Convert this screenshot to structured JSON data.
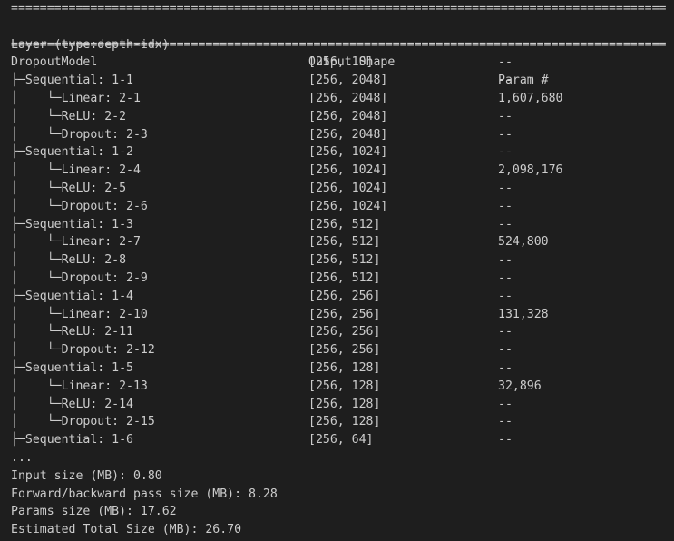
{
  "header": {
    "layer": "Layer (type:depth-idx)",
    "shape": "Output Shape",
    "params": "Param #"
  },
  "rule_char": "=",
  "rows": [
    {
      "layer": "DropoutModel",
      "shape": "[256, 10]",
      "params": "--"
    },
    {
      "layer": "├─Sequential: 1-1",
      "shape": "[256, 2048]",
      "params": "--"
    },
    {
      "layer": "│    └─Linear: 2-1",
      "shape": "[256, 2048]",
      "params": "1,607,680"
    },
    {
      "layer": "│    └─ReLU: 2-2",
      "shape": "[256, 2048]",
      "params": "--"
    },
    {
      "layer": "│    └─Dropout: 2-3",
      "shape": "[256, 2048]",
      "params": "--"
    },
    {
      "layer": "├─Sequential: 1-2",
      "shape": "[256, 1024]",
      "params": "--"
    },
    {
      "layer": "│    └─Linear: 2-4",
      "shape": "[256, 1024]",
      "params": "2,098,176"
    },
    {
      "layer": "│    └─ReLU: 2-5",
      "shape": "[256, 1024]",
      "params": "--"
    },
    {
      "layer": "│    └─Dropout: 2-6",
      "shape": "[256, 1024]",
      "params": "--"
    },
    {
      "layer": "├─Sequential: 1-3",
      "shape": "[256, 512]",
      "params": "--"
    },
    {
      "layer": "│    └─Linear: 2-7",
      "shape": "[256, 512]",
      "params": "524,800"
    },
    {
      "layer": "│    └─ReLU: 2-8",
      "shape": "[256, 512]",
      "params": "--"
    },
    {
      "layer": "│    └─Dropout: 2-9",
      "shape": "[256, 512]",
      "params": "--"
    },
    {
      "layer": "├─Sequential: 1-4",
      "shape": "[256, 256]",
      "params": "--"
    },
    {
      "layer": "│    └─Linear: 2-10",
      "shape": "[256, 256]",
      "params": "131,328"
    },
    {
      "layer": "│    └─ReLU: 2-11",
      "shape": "[256, 256]",
      "params": "--"
    },
    {
      "layer": "│    └─Dropout: 2-12",
      "shape": "[256, 256]",
      "params": "--"
    },
    {
      "layer": "├─Sequential: 1-5",
      "shape": "[256, 128]",
      "params": "--"
    },
    {
      "layer": "│    └─Linear: 2-13",
      "shape": "[256, 128]",
      "params": "32,896"
    },
    {
      "layer": "│    └─ReLU: 2-14",
      "shape": "[256, 128]",
      "params": "--"
    },
    {
      "layer": "│    └─Dropout: 2-15",
      "shape": "[256, 128]",
      "params": "--"
    },
    {
      "layer": "├─Sequential: 1-6",
      "shape": "[256, 64]",
      "params": "--"
    }
  ],
  "ellipsis": "...",
  "summary": {
    "input_size": "Input size (MB): 0.80",
    "pass_size": "Forward/backward pass size (MB): 8.28",
    "params_size": "Params size (MB): 17.62",
    "total_size": "Estimated Total Size (MB): 26.70"
  }
}
